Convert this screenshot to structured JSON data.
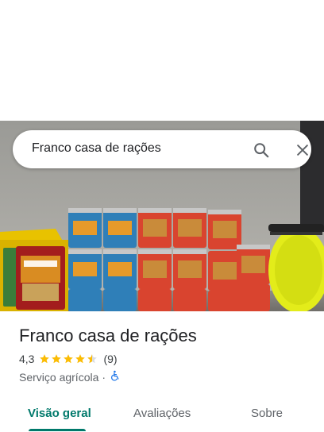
{
  "search": {
    "query": "Franco casa de rações"
  },
  "place": {
    "name": "Franco casa de rações",
    "rating": "4,3",
    "stars_filled": 4.3,
    "review_count": "(9)",
    "category": "Serviço agrícola",
    "separator": "·"
  },
  "tabs": [
    {
      "label": "Visão geral"
    },
    {
      "label": "Avaliações"
    },
    {
      "label": "Sobre"
    }
  ],
  "icons": {
    "search": "search-icon",
    "close": "close-icon",
    "wheelchair": "wheelchair-icon",
    "star": "star-icon"
  },
  "colors": {
    "accent": "#00796b",
    "star": "#fbbc04",
    "accessibility": "#1a73e8"
  }
}
